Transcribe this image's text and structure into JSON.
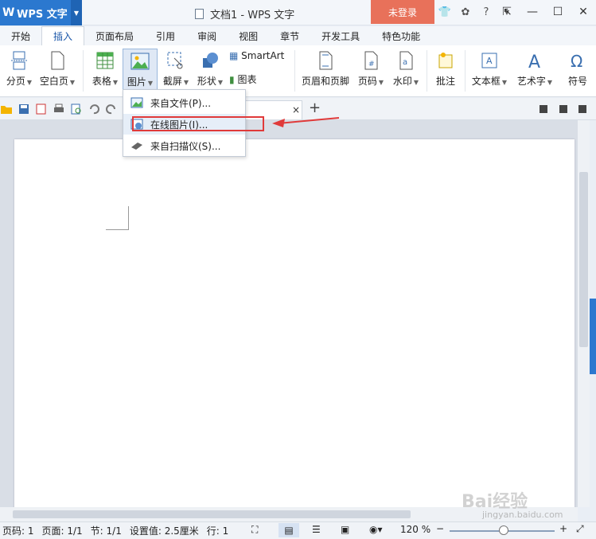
{
  "app": {
    "name": "WPS 文字",
    "logo": "W",
    "window_title": "文档1 - WPS 文字",
    "login_label": "未登录"
  },
  "tabs": [
    "开始",
    "插入",
    "页面布局",
    "引用",
    "审阅",
    "视图",
    "章节",
    "开发工具",
    "特色功能"
  ],
  "active_tab": "插入",
  "ribbon": {
    "page_break": "分页",
    "blank_page": "空白页",
    "table": "表格",
    "picture": "图片",
    "screenshot": "截屏",
    "shape": "形状",
    "smartart": "SmartArt",
    "chart": "图表",
    "header_footer": "页眉和页脚",
    "page_number": "页码",
    "watermark": "水印",
    "comment": "批注",
    "textbox": "文本框",
    "wordart": "艺术字",
    "symbol": "符号"
  },
  "picture_menu": {
    "items": [
      {
        "label": "来自文件(P)...",
        "icon": "image-file-icon"
      },
      {
        "label": "在线图片(I)...",
        "icon": "online-image-icon"
      },
      {
        "label": "来自扫描仪(S)...",
        "icon": "scanner-icon"
      }
    ]
  },
  "status": {
    "page_code": "页码: 1",
    "pages": "页面: 1/1",
    "section": "节: 1/1",
    "setting": "设置值: 2.5厘米",
    "row": "行: 1",
    "zoom": "120 %"
  },
  "watermark": {
    "text": "Bai经验",
    "url": "jingyan.baidu.com"
  },
  "colors": {
    "accent": "#2b78cf",
    "login": "#e8715a",
    "highlight_box": "#e03a3a"
  }
}
